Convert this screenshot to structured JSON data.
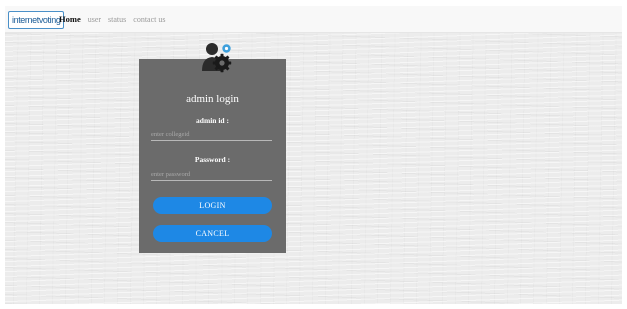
{
  "navbar": {
    "brand": "internetvoting",
    "links": [
      {
        "label": "Home",
        "active": true
      },
      {
        "label": "user",
        "active": false
      },
      {
        "label": "status",
        "active": false
      },
      {
        "label": "contact us",
        "active": false
      }
    ]
  },
  "login": {
    "icon": "admin-settings-icon",
    "title": "admin login",
    "admin_id_label": "admin id :",
    "admin_id_placeholder": "enter collegeid",
    "admin_id_value": "",
    "password_label": "Password :",
    "password_placeholder": "enter password",
    "password_value": "",
    "login_button": "LOGIN",
    "cancel_button": "CANCEL"
  },
  "colors": {
    "card_background": "#6b6b6b",
    "button_blue": "#1e88e5",
    "page_background": "#ececec"
  }
}
